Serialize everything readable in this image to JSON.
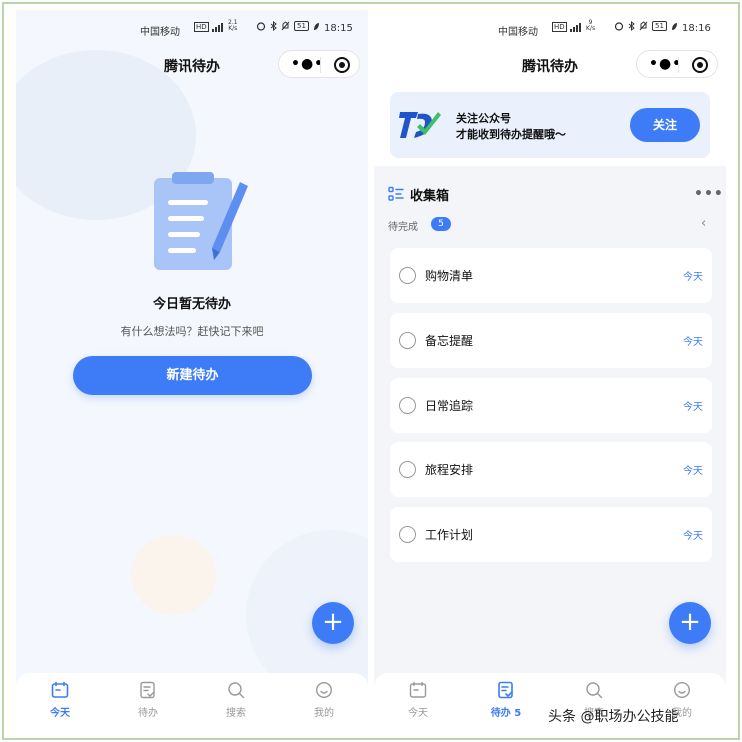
{
  "left": {
    "status": {
      "carrier": "中国移动",
      "net": "HD",
      "speed_value": "2.1",
      "speed_unit": "K/s",
      "battery": "51",
      "time": "18:15"
    },
    "nav": {
      "title": "腾讯待办"
    },
    "empty": {
      "title": "今日暂无待办",
      "subtitle": "有什么想法吗？赶快记下来吧"
    },
    "new_button": "新建待办",
    "tabs": [
      {
        "label": "今天",
        "icon": "calendar-icon",
        "active": true
      },
      {
        "label": "待办",
        "icon": "todo-list-icon",
        "active": false
      },
      {
        "label": "搜索",
        "icon": "search-icon",
        "active": false
      },
      {
        "label": "我的",
        "icon": "smile-icon",
        "active": false
      }
    ]
  },
  "right": {
    "status": {
      "carrier": "中国移动",
      "net": "HD",
      "speed_value": "9",
      "speed_unit": "K/s",
      "battery": "51",
      "time": "18:16"
    },
    "nav": {
      "title": "腾讯待办"
    },
    "banner": {
      "line1": "关注公众号",
      "line2": "才能收到待办提醒哦～",
      "button": "关注"
    },
    "inbox": {
      "title": "收集箱",
      "more": "•••",
      "pending_label": "待完成",
      "pending_count": "5",
      "collapse": "‹"
    },
    "items": [
      {
        "title": "购物清单",
        "date": "今天"
      },
      {
        "title": "备忘提醒",
        "date": "今天"
      },
      {
        "title": "日常追踪",
        "date": "今天"
      },
      {
        "title": "旅程安排",
        "date": "今天"
      },
      {
        "title": "工作计划",
        "date": "今天"
      }
    ],
    "tabs": [
      {
        "label": "今天",
        "icon": "calendar-icon",
        "active": false
      },
      {
        "label": "待办 5",
        "icon": "todo-list-icon",
        "active": true
      },
      {
        "label": "搜索",
        "icon": "search-icon",
        "active": false
      },
      {
        "label": "我的",
        "icon": "smile-icon",
        "active": false
      }
    ]
  },
  "watermark": "头条 @职场办公技能",
  "colors": {
    "accent": "#3e7cf7",
    "frame": "#b7d7a8",
    "banner_bg": "#eaf1fd"
  }
}
